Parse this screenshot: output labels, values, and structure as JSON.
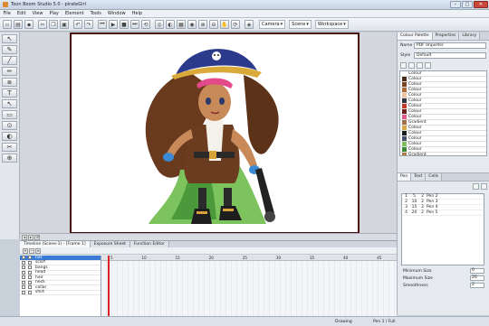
{
  "window": {
    "title": "Toon Boom Studio 5.0 - pirateGirl",
    "buttons": [
      "–",
      "□",
      "✕"
    ]
  },
  "menu": [
    "File",
    "Edit",
    "View",
    "Play",
    "Element",
    "Tools",
    "Window",
    "Help"
  ],
  "toolbar": {
    "camera_label": "Camera",
    "scene_label": "Scene",
    "workspace_label": "Workspace"
  },
  "left_tools": [
    "↖",
    "✎",
    "╱",
    "✏",
    "⧈",
    "T",
    "↖",
    "▭",
    "⊙",
    "◐",
    "✂",
    "⊕"
  ],
  "colour_panel": {
    "tabs": [
      "Colour Palette",
      "Properties",
      "Library"
    ],
    "name_label": "Name",
    "name_value": "PDF Importer",
    "style_label": "Style",
    "style_value": "Default",
    "swatches": [
      {
        "name": "Colour",
        "color": "#ffffff"
      },
      {
        "name": "Colour",
        "color": "#4a2b1a"
      },
      {
        "name": "Colour",
        "color": "#7a4424"
      },
      {
        "name": "Colour",
        "color": "#b36b3a"
      },
      {
        "name": "Colour",
        "color": "#f0c4a0"
      },
      {
        "name": "Colour",
        "color": "#30363e"
      },
      {
        "name": "Colour",
        "color": "#c33a2a"
      },
      {
        "name": "Colour",
        "color": "#6c2018"
      },
      {
        "name": "Colour",
        "color": "#e25a8c"
      },
      {
        "name": "Gradient",
        "color": "#a07048"
      },
      {
        "name": "Colour",
        "color": "#d9a64a"
      },
      {
        "name": "Colour",
        "color": "#1c1c1c"
      },
      {
        "name": "Colour",
        "color": "#44506a"
      },
      {
        "name": "Colour",
        "color": "#7cbf5c"
      },
      {
        "name": "Colour",
        "color": "#3a8a3a"
      },
      {
        "name": "Gradient",
        "color": "#b07a40"
      }
    ]
  },
  "pen_panel": {
    "tabs": [
      "Pen",
      "Text",
      "Cells"
    ],
    "pens": [
      {
        "a": "1",
        "b": "5",
        "c": "2",
        "name": "Pen 2"
      },
      {
        "a": "2",
        "b": "10",
        "c": "2",
        "name": "Pen 3"
      },
      {
        "a": "3",
        "b": "15",
        "c": "2",
        "name": "Pen 4"
      },
      {
        "a": "4",
        "b": "20",
        "c": "2",
        "name": "Pen 5"
      }
    ],
    "min_size_label": "Minimum Size",
    "min_size_value": "0",
    "max_size_label": "Maximum Size",
    "max_size_value": "20",
    "smoothness_label": "Smoothness",
    "smoothness_value": "2"
  },
  "timeline": {
    "tabs": [
      "Timeline (Scene-1) - [Frame 1]",
      "Exposure Sheet",
      "Function Editor"
    ],
    "layers": [
      "hat",
      "scarf",
      "bangs",
      "head",
      "hair",
      "neck",
      "collar",
      "shirt"
    ],
    "ruler": [
      "5",
      "10",
      "15",
      "20",
      "25",
      "30",
      "35",
      "40",
      "45"
    ]
  },
  "status": {
    "mode": "Drawing",
    "pen": "Pen 1 / Full"
  }
}
